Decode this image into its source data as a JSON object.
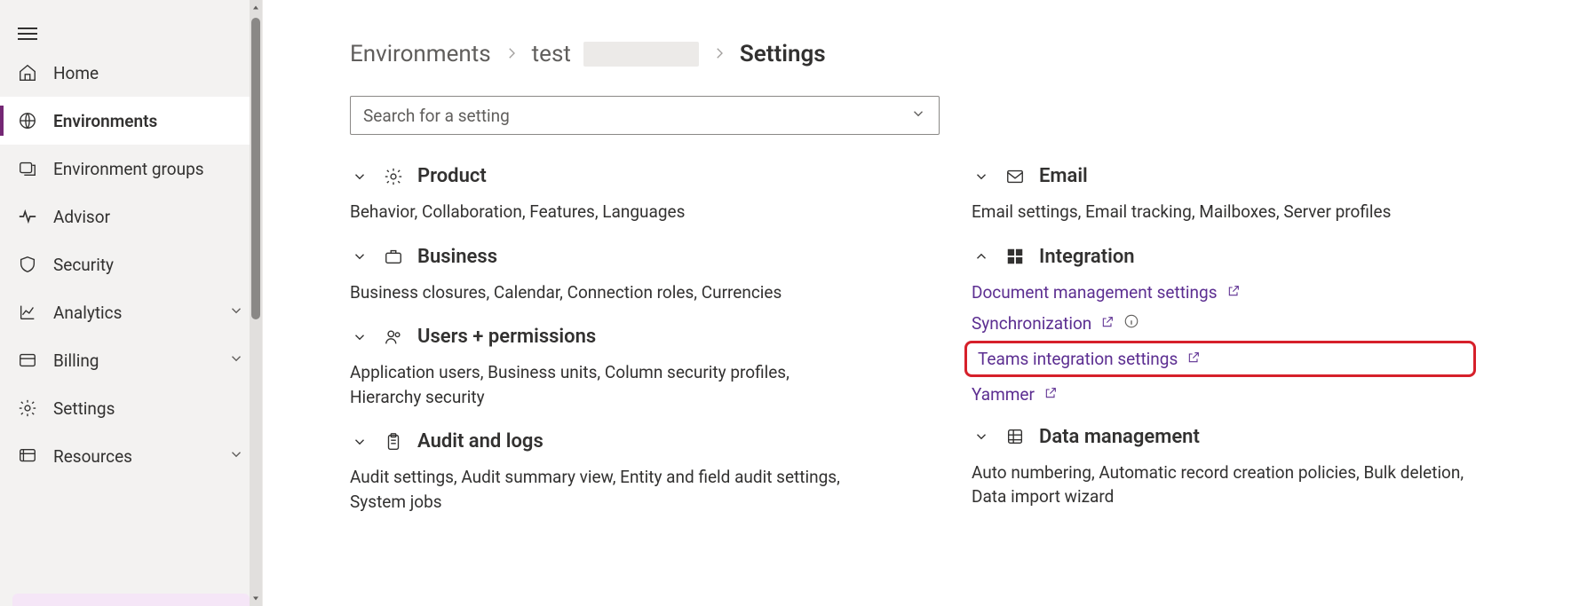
{
  "sidebar": {
    "items": [
      {
        "label": "Home",
        "icon": "home",
        "expandable": false
      },
      {
        "label": "Environments",
        "icon": "globe",
        "active": true,
        "expandable": false
      },
      {
        "label": "Environment groups",
        "icon": "env-groups",
        "expandable": false
      },
      {
        "label": "Advisor",
        "icon": "pulse",
        "expandable": false
      },
      {
        "label": "Security",
        "icon": "shield",
        "expandable": false
      },
      {
        "label": "Analytics",
        "icon": "analytics",
        "expandable": true
      },
      {
        "label": "Billing",
        "icon": "billing",
        "expandable": true
      },
      {
        "label": "Settings",
        "icon": "gear",
        "expandable": false
      },
      {
        "label": "Resources",
        "icon": "resources",
        "expandable": true
      }
    ]
  },
  "breadcrumb": {
    "items": [
      {
        "label": "Environments"
      },
      {
        "label": "test",
        "redacted_suffix": true
      },
      {
        "label": "Settings",
        "current": true
      }
    ],
    "separator": "›"
  },
  "search": {
    "placeholder": "Search for a setting"
  },
  "left_sections": [
    {
      "key": "product",
      "title": "Product",
      "expanded": false,
      "icon": "gear",
      "summary": "Behavior, Collaboration, Features, Languages"
    },
    {
      "key": "business",
      "title": "Business",
      "expanded": false,
      "icon": "briefcase",
      "summary": "Business closures, Calendar, Connection roles, Currencies"
    },
    {
      "key": "users",
      "title": "Users + permissions",
      "expanded": false,
      "icon": "people",
      "summary": "Application users, Business units, Column security profiles, Hierarchy security"
    },
    {
      "key": "audit",
      "title": "Audit and logs",
      "expanded": false,
      "icon": "clipboard",
      "summary": "Audit settings, Audit summary view, Entity and field audit settings, System jobs"
    }
  ],
  "right_sections": [
    {
      "key": "email",
      "title": "Email",
      "expanded": false,
      "icon": "mail",
      "summary": "Email settings, Email tracking, Mailboxes, Server profiles"
    },
    {
      "key": "integration",
      "title": "Integration",
      "expanded": true,
      "icon": "windows",
      "links": [
        {
          "label": "Document management settings",
          "external": true
        },
        {
          "label": "Synchronization",
          "external": true,
          "info": true
        },
        {
          "label": "Teams integration settings",
          "external": true,
          "highlighted": true
        },
        {
          "label": "Yammer",
          "external": true
        }
      ]
    },
    {
      "key": "data",
      "title": "Data management",
      "expanded": false,
      "icon": "database",
      "summary": "Auto numbering, Automatic record creation policies, Bulk deletion, Data import wizard"
    }
  ]
}
